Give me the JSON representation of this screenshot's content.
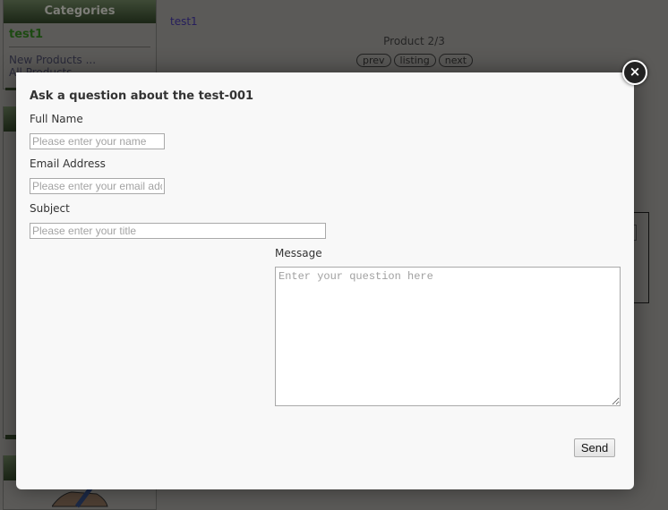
{
  "background": {
    "sidebar": {
      "heading": "Categories",
      "active_category": "test1",
      "links": [
        "New Products ...",
        "All Products ..."
      ]
    },
    "breadcrumb_link": "test1",
    "product_counter": "Product 2/3",
    "nav_buttons": {
      "prev": "prev",
      "listing": "listing",
      "next": "next"
    }
  },
  "modal": {
    "close_icon": "×",
    "title": "Ask a question about the test-001",
    "full_name": {
      "label": "Full Name",
      "value": "",
      "placeholder": "Please enter your name"
    },
    "email": {
      "label": "Email Address",
      "value": "",
      "placeholder": "Please enter your email address"
    },
    "subject": {
      "label": "Subject",
      "value": "",
      "placeholder": "Please enter your title"
    },
    "message": {
      "label": "Message",
      "value": "",
      "placeholder": "Enter your question here"
    },
    "send_label": "Send"
  }
}
